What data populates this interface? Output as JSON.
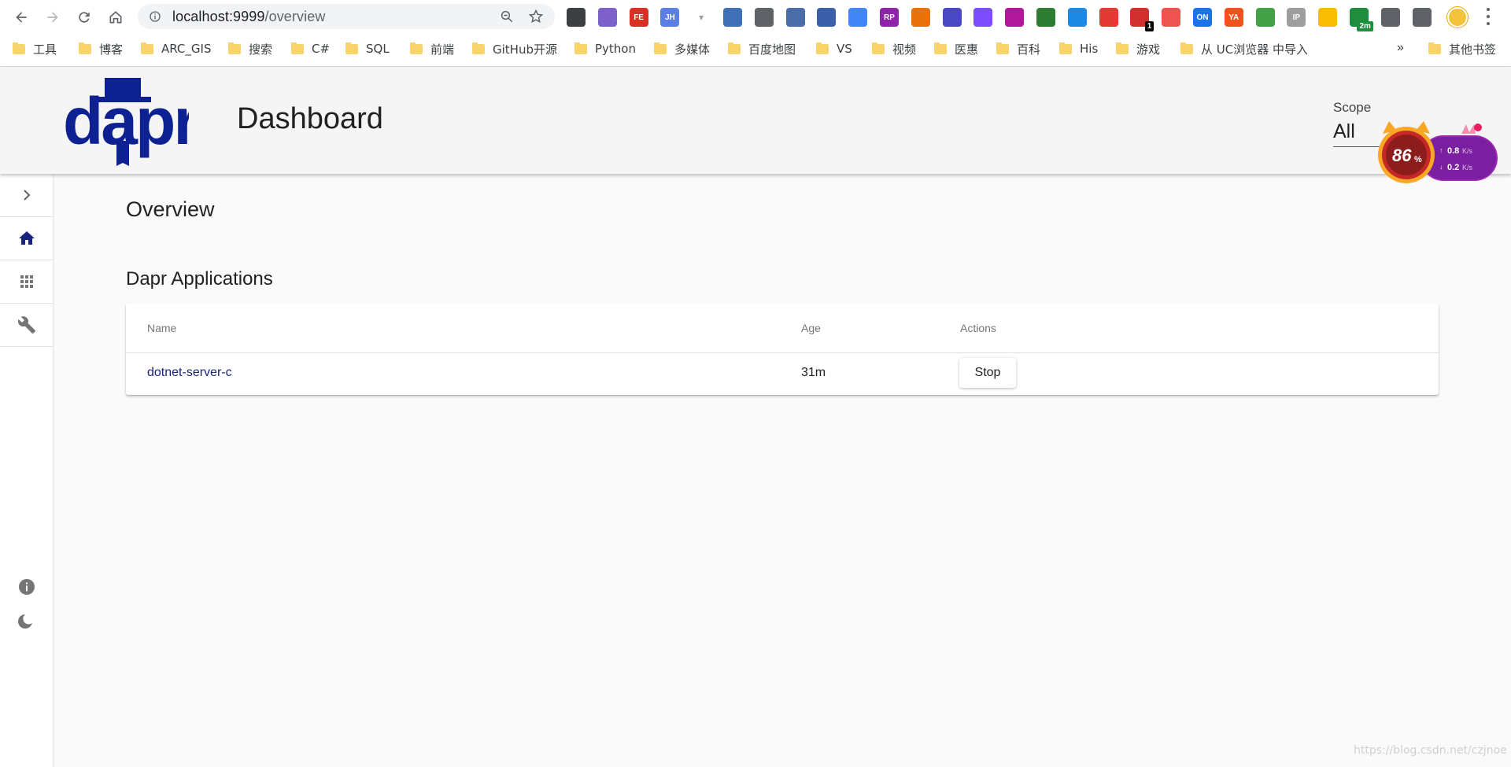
{
  "browser": {
    "url_host": "localhost:9999",
    "url_path": "/overview",
    "extensions": [
      {
        "name": "qr-code-icon",
        "color": "#3c4043",
        "label": ""
      },
      {
        "name": "pen-extension-icon",
        "color": "#7b61c9",
        "label": ""
      },
      {
        "name": "fe-extension-icon",
        "color": "#d93025",
        "label": "FE"
      },
      {
        "name": "jh-extension-icon",
        "color": "#5b7ee5",
        "label": "JH"
      },
      {
        "name": "dropdown-extension-icon",
        "color": "#9aa0a6",
        "label": ""
      },
      {
        "name": "apps-extension-icon",
        "color": "#3f6fb5",
        "label": ""
      },
      {
        "name": "bookmark-extension-icon",
        "color": "#5f6368",
        "label": ""
      },
      {
        "name": "star-box-extension-icon",
        "color": "#4a6da7",
        "label": ""
      },
      {
        "name": "window-extension-icon",
        "color": "#3b5fa8",
        "label": ""
      },
      {
        "name": "translate-extension-icon",
        "color": "#4285f4",
        "label": ""
      },
      {
        "name": "rp-extension-icon",
        "color": "#8e24aa",
        "label": "RP"
      },
      {
        "name": "fox-extension-icon",
        "color": "#e8710a",
        "label": ""
      },
      {
        "name": "s-extension-icon",
        "color": "#4a47c4",
        "label": ""
      },
      {
        "name": "gear-extension-icon",
        "color": "#7c4dff",
        "label": ""
      },
      {
        "name": "cube-extension-icon",
        "color": "#b0179b",
        "label": ""
      },
      {
        "name": "leaf-extension-icon",
        "color": "#2e7d32",
        "label": ""
      },
      {
        "name": "hexagon-extension-icon",
        "color": "#1e88e5",
        "label": ""
      },
      {
        "name": "clover-extension-icon",
        "color": "#e53935",
        "label": ""
      },
      {
        "name": "todo-extension-icon",
        "color": "#d32f2f",
        "label": "",
        "badge": "1"
      },
      {
        "name": "circle-extension-icon",
        "color": "#ef5350",
        "label": ""
      },
      {
        "name": "on-extension-icon",
        "color": "#1a73e8",
        "label": "ON"
      },
      {
        "name": "ya-extension-icon",
        "color": "#f4511e",
        "label": "YA"
      },
      {
        "name": "globe-extension-icon",
        "color": "#43a047",
        "label": ""
      },
      {
        "name": "ip-extension-icon",
        "color": "#9e9e9e",
        "label": "IP"
      },
      {
        "name": "colorful-extension-icon",
        "color": "#fbbc04",
        "label": ""
      },
      {
        "name": "timer-extension-icon",
        "color": "#1e8e3e",
        "label": "",
        "badge": "2m",
        "badge_green": true
      },
      {
        "name": "snapshot-extension-icon",
        "color": "#5f6368",
        "label": ""
      },
      {
        "name": "puzzle-extensions-icon",
        "color": "#5f6368",
        "label": ""
      }
    ],
    "bookmarks": [
      "工具",
      "博客",
      "ARC_GIS",
      "搜索",
      "C#",
      "SQL",
      "前端",
      "GitHub开源",
      "Python",
      "多媒体",
      "百度地图",
      "VS",
      "视频",
      "医惠",
      "百科",
      "His",
      "游戏",
      "从 UC浏览器 中导入"
    ],
    "bookmarks_more": "»",
    "other_bookmarks": "其他书签"
  },
  "header": {
    "title": "Dashboard",
    "scope_label": "Scope",
    "scope_value": "All"
  },
  "speed_widget": {
    "percent": "86",
    "percent_sign": "%",
    "up": "0.8",
    "down": "0.2",
    "unit": "K/s"
  },
  "sidebar": {
    "items": [
      {
        "name": "expand-chevron-icon"
      },
      {
        "name": "home-icon",
        "active": true
      },
      {
        "name": "apps-grid-icon"
      },
      {
        "name": "wrench-icon"
      }
    ]
  },
  "main": {
    "page_title": "Overview",
    "section_title": "Dapr Applications",
    "table": {
      "columns": [
        "Name",
        "Age",
        "Actions"
      ],
      "rows": [
        {
          "name": "dotnet-server-c",
          "age": "31m",
          "action": "Stop"
        }
      ]
    }
  },
  "watermark": "https://blog.csdn.net/czjnoe",
  "colors": {
    "brand": "#0d2192",
    "link": "#1a237e",
    "header_bg": "#f5f5f5",
    "page_bg": "#fafafa"
  }
}
